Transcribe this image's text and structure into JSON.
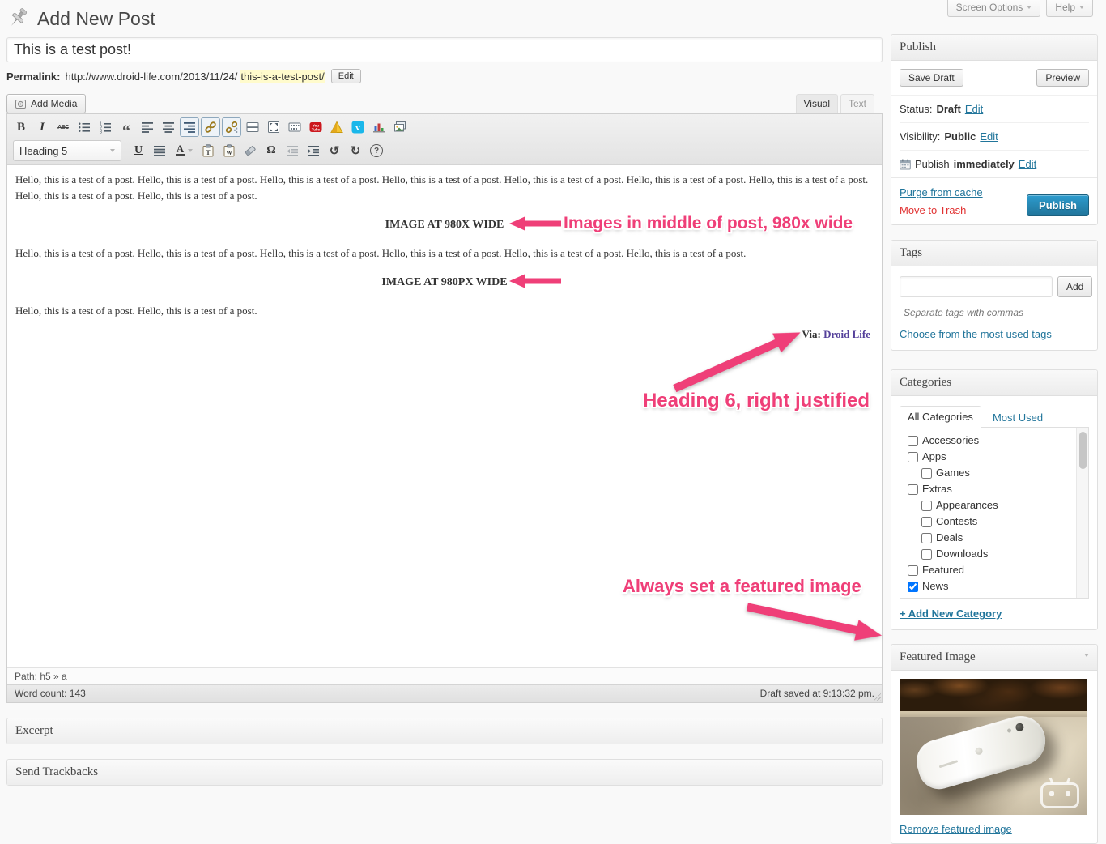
{
  "header": {
    "title": "Add New Post",
    "screen_options": "Screen Options",
    "help": "Help"
  },
  "post": {
    "title": "This is a test post!",
    "permalink_label": "Permalink:",
    "permalink_base": "http://www.droid-life.com/2013/11/24/",
    "permalink_slug": "this-is-a-test-post/",
    "edit_button": "Edit",
    "add_media": "Add Media",
    "tabs": {
      "visual": "Visual",
      "text": "Text"
    }
  },
  "toolbar": {
    "heading_value": "Heading 5",
    "glyphs": {
      "bold": "B",
      "italic": "I",
      "strike": "ABC",
      "blockquote": "“",
      "underline": "U",
      "fontcolor": "A",
      "omega": "Ω",
      "undo": "↺",
      "redo": "↻",
      "help": "?"
    }
  },
  "content": {
    "paragraph1": "Hello, this is a test of a post. Hello, this is a test of a post. Hello, this is a test of a post. Hello, this is a test of a post. Hello, this is a test of a post. Hello, this is a test of a post. Hello, this is a test of a post. Hello, this is a test of a post. Hello, this is a test of a post.",
    "heading1": "IMAGE AT 980X WIDE",
    "paragraph2": "Hello, this is a test of a post. Hello, this is a test of a post. Hello, this is a test of a post. Hello, this is a test of a post. Hello, this is a test of a post. Hello, this is a test of a post.",
    "heading2": "IMAGE AT 980PX WIDE",
    "paragraph3": "Hello, this is a test of a post. Hello, this is a test of a post.",
    "via_label": "Via:",
    "via_link": "Droid Life"
  },
  "annotations": {
    "images_mid": {
      "text": "Images in middle of post, 980x wide"
    },
    "heading6": {
      "text": "Heading 6, right justified"
    },
    "featured": {
      "text": "Always set a featured image"
    }
  },
  "statusbar": {
    "path": "Path: h5 » a",
    "word_count": "Word count: 143",
    "draft_saved": "Draft saved at 9:13:32 pm."
  },
  "panels": {
    "excerpt": "Excerpt",
    "trackbacks": "Send Trackbacks"
  },
  "publish": {
    "title": "Publish",
    "save_draft": "Save Draft",
    "preview": "Preview",
    "status_label": "Status:",
    "status_value": "Draft",
    "visibility_label": "Visibility:",
    "visibility_value": "Public",
    "schedule_prefix": "Publish",
    "schedule_value": "immediately",
    "edit_link": "Edit",
    "purge_link": "Purge from cache",
    "trash_link": "Move to Trash",
    "publish_button": "Publish"
  },
  "tags": {
    "title": "Tags",
    "add_button": "Add",
    "hint": "Separate tags with commas",
    "choose_link": "Choose from the most used tags"
  },
  "categories": {
    "title": "Categories",
    "tab_all": "All Categories",
    "tab_most": "Most Used",
    "add_new": "+ Add New Category",
    "items": [
      {
        "label": "Accessories",
        "depth": 0,
        "checked": false
      },
      {
        "label": "Apps",
        "depth": 0,
        "checked": false
      },
      {
        "label": "Games",
        "depth": 1,
        "checked": false
      },
      {
        "label": "Extras",
        "depth": 0,
        "checked": false
      },
      {
        "label": "Appearances",
        "depth": 1,
        "checked": false
      },
      {
        "label": "Contests",
        "depth": 1,
        "checked": false
      },
      {
        "label": "Deals",
        "depth": 1,
        "checked": false
      },
      {
        "label": "Downloads",
        "depth": 1,
        "checked": false
      },
      {
        "label": "Featured",
        "depth": 0,
        "checked": false
      },
      {
        "label": "News",
        "depth": 0,
        "checked": true
      }
    ]
  },
  "featured_image": {
    "title": "Featured Image",
    "remove_link": "Remove featured image"
  },
  "colors": {
    "annotation_pink": "#ef3f78",
    "link_blue": "#21759b",
    "publish_button_blue": "#21759b",
    "trash_red": "#e13232",
    "slug_highlight_yellow": "#fffbcc",
    "via_link_purple": "#54409a",
    "youtube_red": "#cc181e",
    "vimeo_teal": "#1ab7ea"
  }
}
